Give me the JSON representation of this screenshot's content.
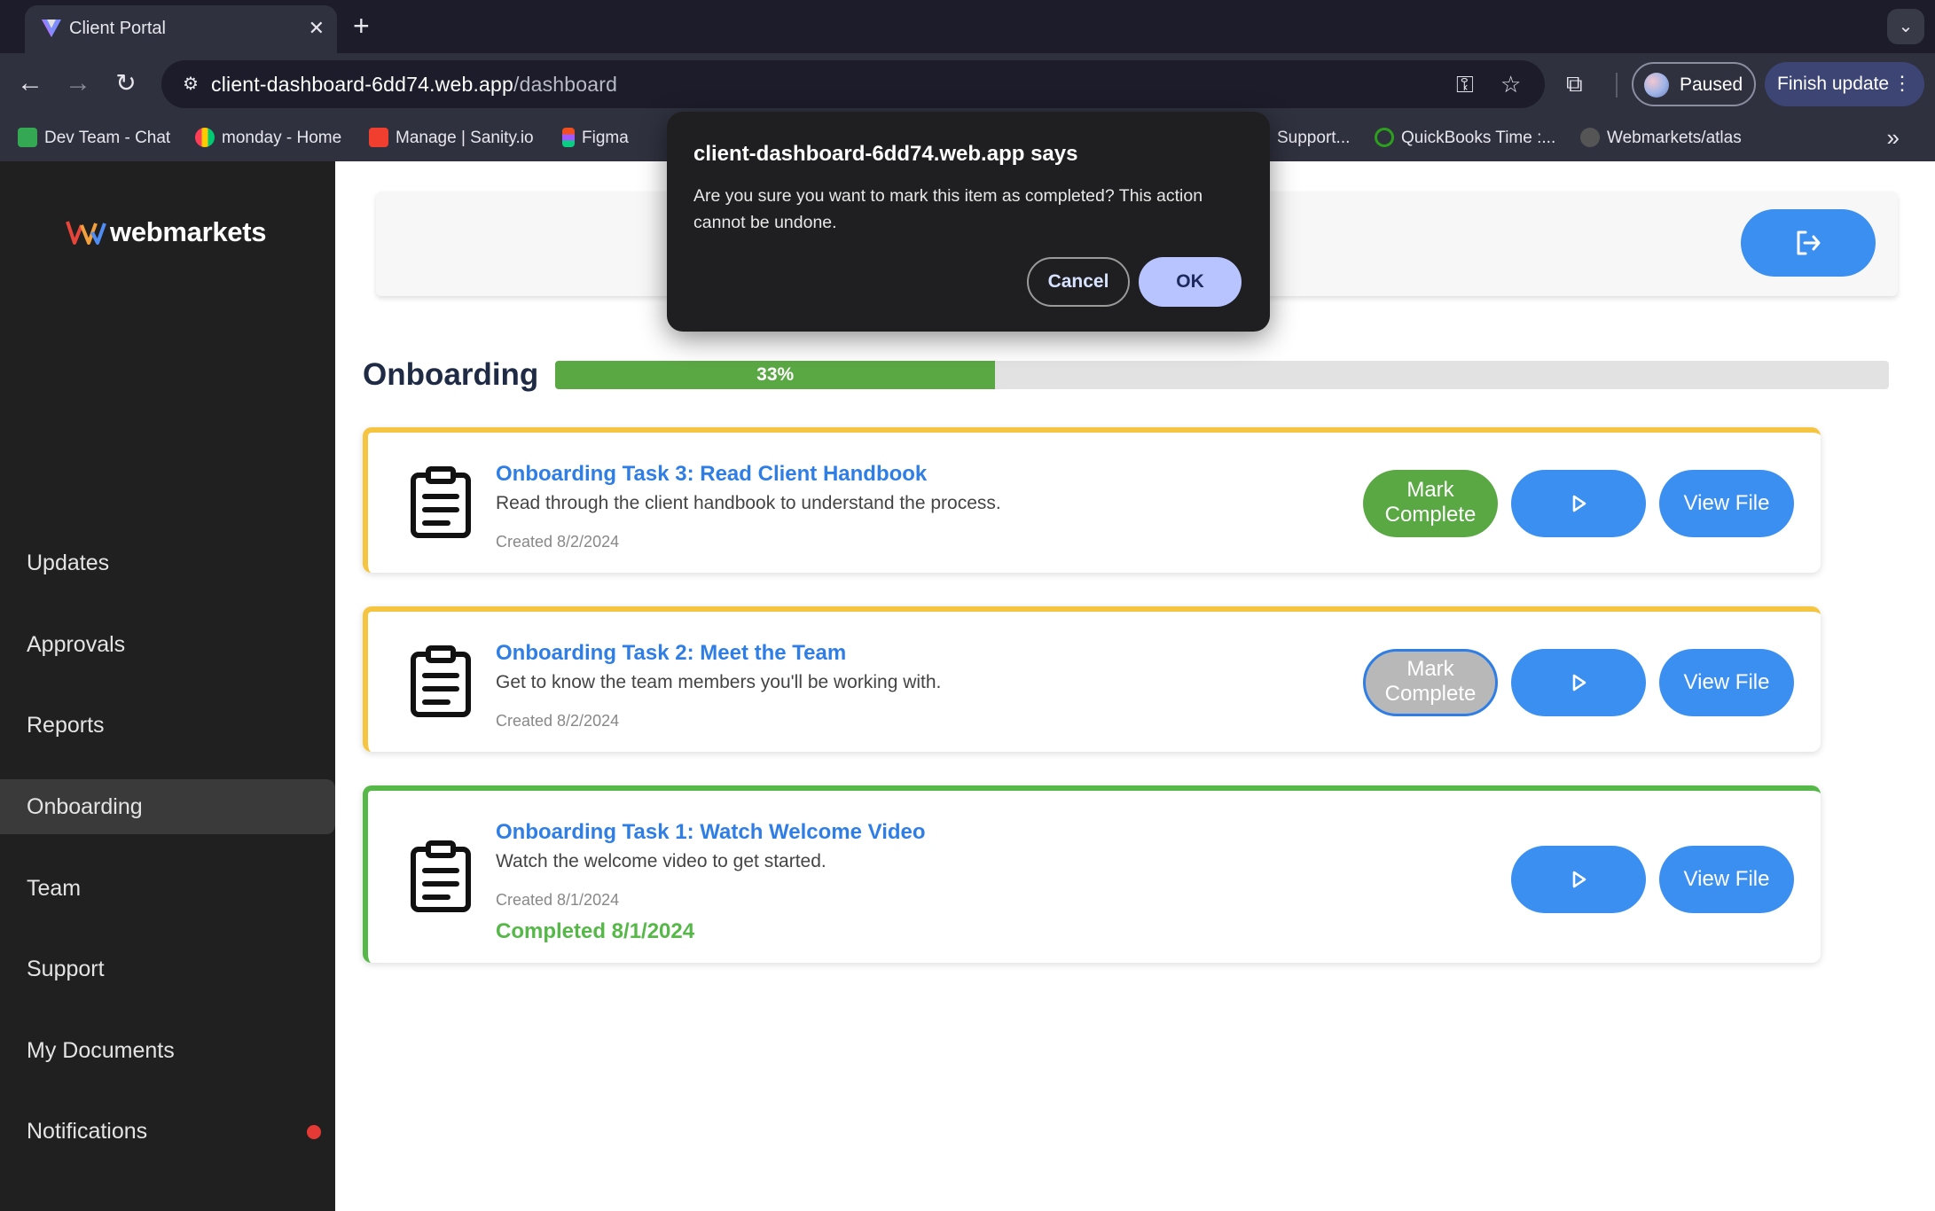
{
  "browser": {
    "tab_title": "Client Portal",
    "new_tab_label": "+",
    "url_host": "client-dashboard-6dd74.web.app",
    "url_path": "/dashboard",
    "profile_status": "Paused",
    "finish_update_label": "Finish update",
    "bookmarks": [
      {
        "label": "Dev Team - Chat",
        "icon": "google-chat-icon",
        "color": "#34a853"
      },
      {
        "label": "monday - Home",
        "icon": "monday-icon",
        "color": "#ff3d57"
      },
      {
        "label": "Manage | Sanity.io",
        "icon": "sanity-icon",
        "color": "#f03e2f"
      },
      {
        "label": "Figma",
        "icon": "figma-icon",
        "color": "#a259ff"
      },
      {
        "label": "Support...",
        "icon": "bookmark-icon",
        "color": "#888888"
      },
      {
        "label": "QuickBooks Time :...",
        "icon": "quickbooks-time-icon",
        "color": "#2ca01c"
      },
      {
        "label": "Webmarkets/atlas",
        "icon": "github-icon",
        "color": "#444444"
      }
    ]
  },
  "sidebar": {
    "logo_text": "webmarkets",
    "active": "Onboarding",
    "items": [
      {
        "label": "Updates"
      },
      {
        "label": "Approvals"
      },
      {
        "label": "Reports"
      },
      {
        "label": "Onboarding"
      },
      {
        "label": "Team"
      },
      {
        "label": "Support"
      },
      {
        "label": "My Documents"
      },
      {
        "label": "Notifications",
        "has_alert": true
      }
    ]
  },
  "main": {
    "title": "Onboarding",
    "progress": {
      "percent": 33,
      "label": "33%"
    },
    "tasks": [
      {
        "title": "Onboarding Task 3: Read Client Handbook",
        "description": "Read through the client handbook to understand the process.",
        "created": "Created 8/2/2024",
        "status": "pending",
        "mark_label": "Mark Complete",
        "view_label": "View File"
      },
      {
        "title": "Onboarding Task 2: Meet the Team",
        "description": "Get to know the team members you'll be working with.",
        "created": "Created 8/2/2024",
        "status": "pending",
        "mark_label": "Mark Complete",
        "view_label": "View File"
      },
      {
        "title": "Onboarding Task 1: Watch Welcome Video",
        "description": "Watch the welcome video to get started.",
        "created": "Created 8/1/2024",
        "status": "completed",
        "completed": "Completed 8/1/2024",
        "view_label": "View File"
      }
    ]
  },
  "dialog": {
    "title": "client-dashboard-6dd74.web.app says",
    "message": "Are you sure you want to mark this item as completed? This action cannot be undone.",
    "cancel_label": "Cancel",
    "ok_label": "OK"
  },
  "colors": {
    "accent_blue": "#3b8ff0",
    "success_green": "#5aa843",
    "pending_yellow": "#f5c542",
    "sidebar_bg": "#202020",
    "alert_red": "#e53935"
  }
}
